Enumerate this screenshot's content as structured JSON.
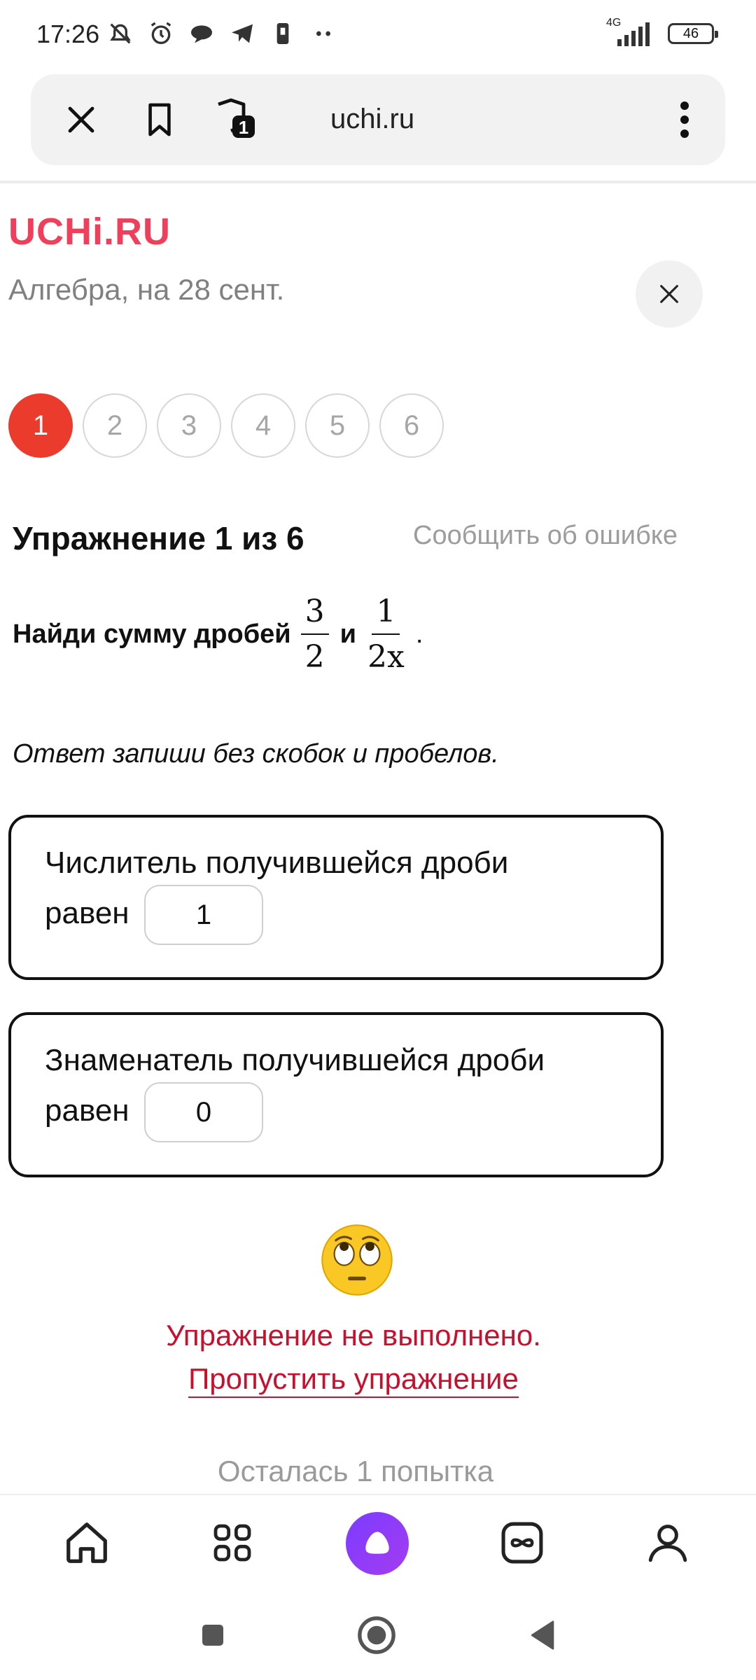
{
  "status_bar": {
    "time": "17:26",
    "network": "4G",
    "battery": "46"
  },
  "browser": {
    "url": "uchi.ru",
    "tab_count": "1",
    "icons": [
      "close-icon",
      "bookmark-icon",
      "shield-icon",
      "more-vert-icon"
    ]
  },
  "header": {
    "logo": "UCHi.RU",
    "subtitle": "Алгебра, на 28 сент."
  },
  "steps": [
    "1",
    "2",
    "3",
    "4",
    "5",
    "6"
  ],
  "active_step": "1",
  "exercise": {
    "title": "Упражнение 1 из 6",
    "report": "Сообщить об ошибке",
    "task_text": "Найди сумму дробей",
    "fraction1_num": "3",
    "fraction1_den": "2",
    "conjunction": "и",
    "fraction2_num": "1",
    "fraction2_den": "2x",
    "period": ".",
    "hint": "Ответ запиши без скобок и пробелов."
  },
  "answers": {
    "numerator_label": "Числитель получившейся дроби",
    "numerator_equals": "равен",
    "numerator_value": "1",
    "denominator_label": "Знаменатель получившейся дроби",
    "denominator_equals": "равен",
    "denominator_value": "0"
  },
  "result": {
    "emoji": "face-with-rolling-eyes",
    "message": "Упражнение не выполнено.",
    "skip_link": "Пропустить упражнение",
    "attempts": "Осталась 1 попытка"
  },
  "colors": {
    "brand": "#ef3f5b",
    "active_step": "#ea3b2c",
    "error": "#c8102e",
    "alice": "#8b3cf7"
  }
}
